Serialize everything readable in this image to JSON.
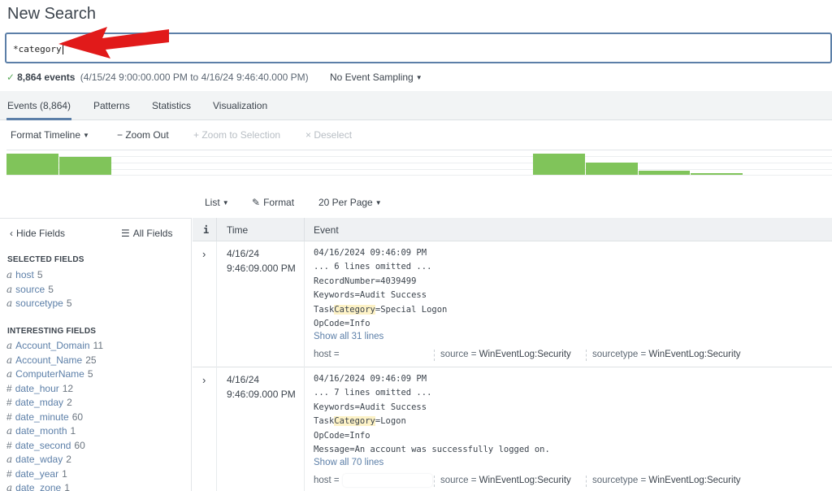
{
  "page": {
    "title": "New Search"
  },
  "search": {
    "query": "*category"
  },
  "status": {
    "check": "✓",
    "event_count": "8,864 events",
    "time_range": "(4/15/24 9:00:00.000 PM to 4/16/24 9:46:40.000 PM)",
    "sampling": "No Event Sampling"
  },
  "tabs": [
    {
      "label": "Events (8,864)"
    },
    {
      "label": "Patterns"
    },
    {
      "label": "Statistics"
    },
    {
      "label": "Visualization"
    }
  ],
  "timeline_toolbar": {
    "format_timeline": "Format Timeline",
    "zoom_out": "− Zoom Out",
    "zoom_selection": "+ Zoom to Selection",
    "deselect": "× Deselect"
  },
  "timeline_histogram": {
    "bar_color": "#80c45a",
    "bars": [
      0.92,
      0.78,
      0,
      0,
      0,
      0,
      0,
      0,
      0,
      0,
      0.92,
      0.55,
      0.18,
      0.08
    ]
  },
  "results_toolbar": {
    "list": "List",
    "format": "Format",
    "per_page": "20 Per Page"
  },
  "sidebar": {
    "hide_fields": "Hide Fields",
    "all_fields": "All Fields",
    "selected_title": "SELECTED FIELDS",
    "selected": [
      {
        "type": "a",
        "name": "host",
        "count": "5"
      },
      {
        "type": "a",
        "name": "source",
        "count": "5"
      },
      {
        "type": "a",
        "name": "sourcetype",
        "count": "5"
      }
    ],
    "interesting_title": "INTERESTING FIELDS",
    "interesting": [
      {
        "type": "a",
        "name": "Account_Domain",
        "count": "11"
      },
      {
        "type": "a",
        "name": "Account_Name",
        "count": "25"
      },
      {
        "type": "a",
        "name": "ComputerName",
        "count": "5"
      },
      {
        "type": "#",
        "name": "date_hour",
        "count": "12"
      },
      {
        "type": "#",
        "name": "date_mday",
        "count": "2"
      },
      {
        "type": "#",
        "name": "date_minute",
        "count": "60"
      },
      {
        "type": "a",
        "name": "date_month",
        "count": "1"
      },
      {
        "type": "#",
        "name": "date_second",
        "count": "60"
      },
      {
        "type": "a",
        "name": "date_wday",
        "count": "2"
      },
      {
        "type": "#",
        "name": "date_year",
        "count": "1"
      },
      {
        "type": "a",
        "name": "date_zone",
        "count": "1"
      }
    ]
  },
  "table": {
    "col_info": "i",
    "col_time": "Time",
    "col_event": "Event"
  },
  "events": [
    {
      "date": "4/16/24",
      "time": "9:46:09.000 PM",
      "lines": [
        "04/16/2024 09:46:09 PM",
        "... 6 lines omitted ...",
        "RecordNumber=4039499",
        "Keywords=Audit Success"
      ],
      "task_prefix": "Task",
      "task_hl": "Category",
      "task_suffix": "=Special Logon",
      "after_lines": [
        "OpCode=Info"
      ],
      "show_all": "Show all 31 lines",
      "host_label": "host =",
      "source_label": "source =",
      "source_value": "WinEventLog:Security",
      "sourcetype_label": "sourcetype =",
      "sourcetype_value": "WinEventLog:Security"
    },
    {
      "date": "4/16/24",
      "time": "9:46:09.000 PM",
      "lines": [
        "04/16/2024 09:46:09 PM",
        "... 7 lines omitted ...",
        "Keywords=Audit Success"
      ],
      "task_prefix": "Task",
      "task_hl": "Category",
      "task_suffix": "=Logon",
      "after_lines": [
        "OpCode=Info",
        "Message=An account was successfully logged on."
      ],
      "show_all": "Show all 70 lines",
      "host_label": "host =",
      "source_label": "source =",
      "source_value": "WinEventLog:Security",
      "sourcetype_label": "sourcetype =",
      "sourcetype_value": "WinEventLog:Security"
    }
  ]
}
